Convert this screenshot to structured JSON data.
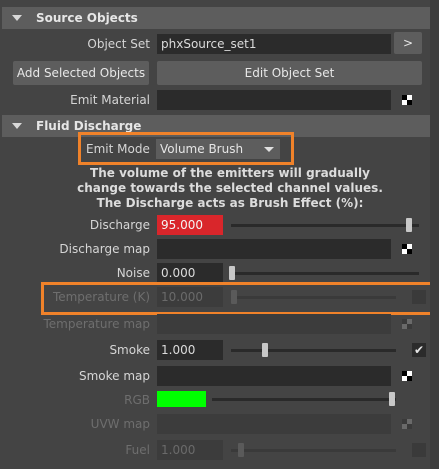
{
  "source_objects": {
    "title": "Source Objects",
    "object_set_label": "Object Set",
    "object_set_value": "phxSource_set1",
    "arrow_button": ">",
    "add_selected_button": "Add Selected Objects",
    "edit_object_set_button": "Edit Object Set",
    "emit_material_label": "Emit Material"
  },
  "fluid_discharge": {
    "title": "Fluid Discharge",
    "emit_mode_label": "Emit Mode",
    "emit_mode_value": "Volume Brush",
    "info_line1": "The volume of the emitters will gradually",
    "info_line2": "change towards the selected channel values.",
    "info_line3": "The Discharge acts as Brush Effect (%):",
    "discharge_label": "Discharge",
    "discharge_value": "95.000",
    "discharge_fraction": 0.95,
    "discharge_map_label": "Discharge map",
    "noise_label": "Noise",
    "noise_value": "0.000",
    "noise_fraction": 0.0,
    "temperature_label": "Temperature (K)",
    "temperature_value": "10.000",
    "temperature_fraction": 0.0,
    "temperature_map_label": "Temperature map",
    "smoke_label": "Smoke",
    "smoke_value": "1.000",
    "smoke_fraction": 0.13,
    "smoke_checked": true,
    "smoke_map_label": "Smoke map",
    "rgb_label": "RGB",
    "rgb_color": "#00ff00",
    "uvw_map_label": "UVW map",
    "fuel_label": "Fuel",
    "fuel_value": "1.000"
  },
  "colors": {
    "highlight": "#f0822a",
    "discharge_field": "#d9262b"
  },
  "icons": {
    "section_toggle": "triangle-down-icon",
    "dropdown": "caret-down-icon",
    "checkmark": "checkmark-icon",
    "texture_map": "checker-icon"
  }
}
